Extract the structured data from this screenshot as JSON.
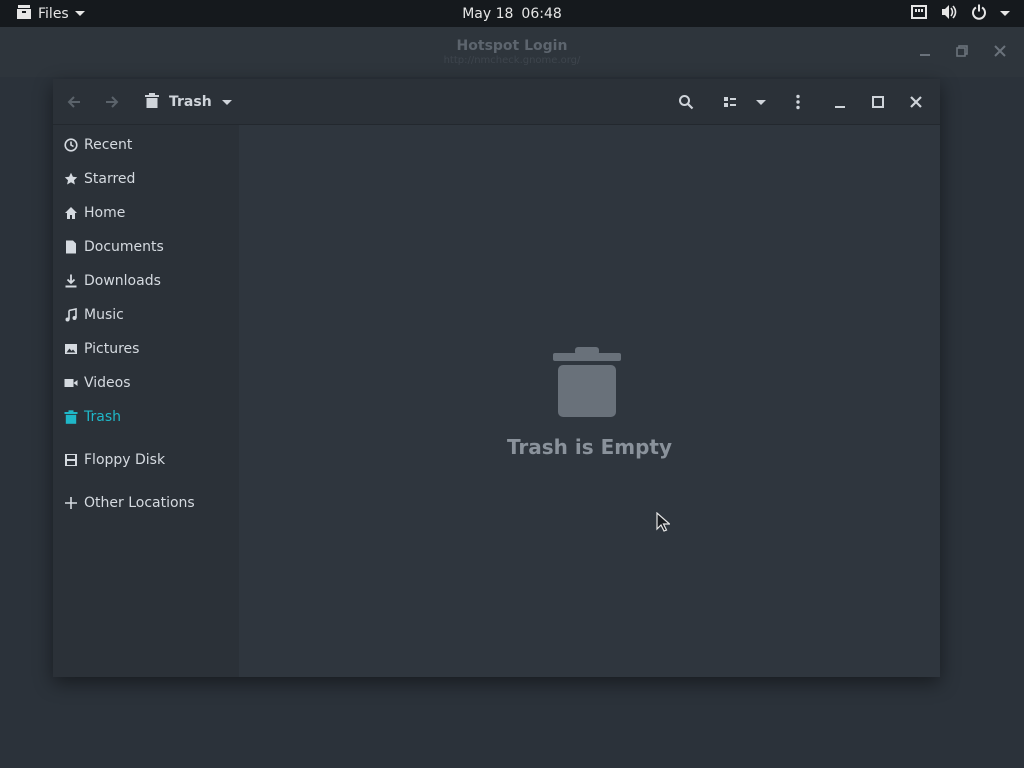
{
  "topbar": {
    "app_name": "Files",
    "date": "May 18",
    "time": "06:48"
  },
  "background_window": {
    "title": "Hotspot Login",
    "url": "http://nmcheck.gnome.org/"
  },
  "files_window": {
    "location": "Trash",
    "sidebar": {
      "items": [
        {
          "label": "Recent",
          "icon": "clock-icon"
        },
        {
          "label": "Starred",
          "icon": "star-icon"
        },
        {
          "label": "Home",
          "icon": "home-icon"
        },
        {
          "label": "Documents",
          "icon": "document-icon"
        },
        {
          "label": "Downloads",
          "icon": "download-icon"
        },
        {
          "label": "Music",
          "icon": "music-icon"
        },
        {
          "label": "Pictures",
          "icon": "picture-icon"
        },
        {
          "label": "Videos",
          "icon": "video-icon"
        },
        {
          "label": "Trash",
          "icon": "trash-icon",
          "active": true
        },
        {
          "label": "Floppy Disk",
          "icon": "floppy-icon"
        },
        {
          "label": "Other Locations",
          "icon": "plus-icon"
        }
      ]
    },
    "empty_state": {
      "label": "Trash is Empty"
    }
  },
  "colors": {
    "accent": "#1fb7c8",
    "topbar": "#15191d",
    "window": "#2f363e",
    "sidebar": "#2b3138"
  }
}
